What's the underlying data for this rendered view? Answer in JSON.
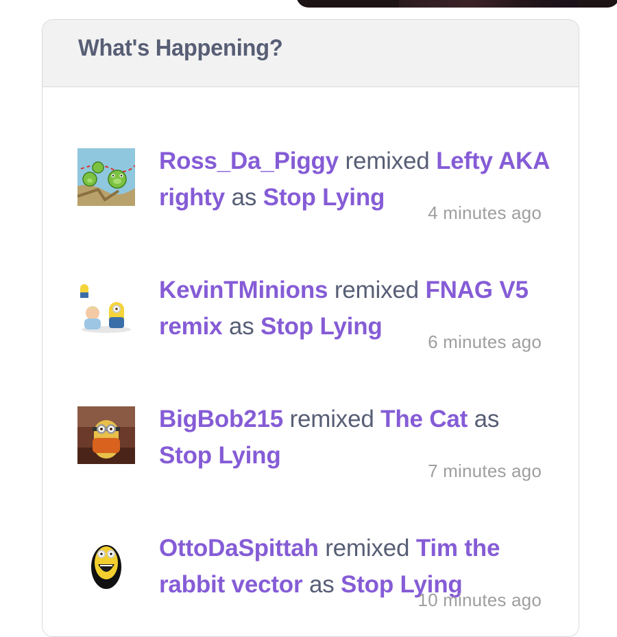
{
  "panel": {
    "title": "What's Happening?"
  },
  "feed": [
    {
      "user": "Ross_Da_Piggy",
      "action": "remixed",
      "source": "Lefty AKA righty",
      "joiner": "as",
      "project": "Stop Lying",
      "time": "4 minutes ago",
      "avatar": "angry-birds-pigs-avatar"
    },
    {
      "user": "KevinTMinions",
      "action": "remixed",
      "source": "FNAG V5 remix",
      "joiner": "as",
      "project": "Stop Lying",
      "time": "6 minutes ago",
      "avatar": "minion-and-baby-avatar"
    },
    {
      "user": "BigBob215",
      "action": "remixed",
      "source": "The Cat",
      "joiner": "as",
      "project": "Stop Lying",
      "time": "7 minutes ago",
      "avatar": "minion-photo-avatar"
    },
    {
      "user": "OttoDaSpittah",
      "action": "remixed",
      "source": "Tim the rabbit vector",
      "joiner": "as",
      "project": "Stop Lying",
      "time": "10 minutes ago",
      "avatar": "minion-helmet-avatar"
    }
  ],
  "colors": {
    "link": "#855cd6",
    "text": "#575e75",
    "timestamp": "#9e9e9e",
    "header_bg": "#f2f2f2"
  }
}
